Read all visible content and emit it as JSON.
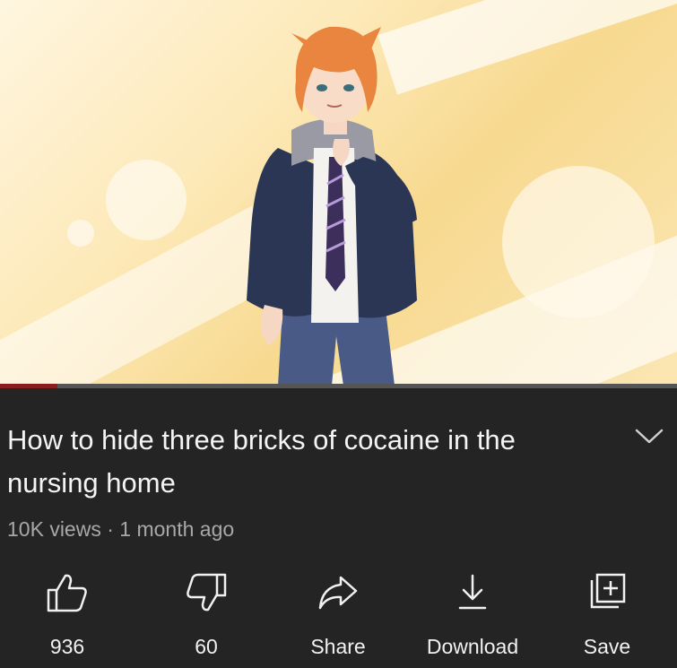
{
  "video": {
    "progress_fraction": 0.085
  },
  "title": "How to hide three bricks of cocaine in the nursing home",
  "meta": {
    "views": "10K views",
    "separator": " · ",
    "age": "1 month ago"
  },
  "actions": {
    "like_count": "936",
    "dislike_count": "60",
    "share_label": "Share",
    "download_label": "Download",
    "save_label": "Save"
  },
  "colors": {
    "background": "#242424",
    "progress": "#8a1d1d",
    "text": "#f1f1f1",
    "meta_text": "#a8a8a8"
  }
}
